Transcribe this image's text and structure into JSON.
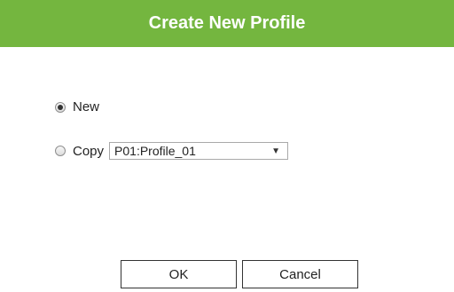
{
  "dialog": {
    "title": "Create New Profile",
    "title_bar_color": "#74b63f",
    "options": {
      "new_label": "New",
      "new_checked": true,
      "copy_label": "Copy",
      "copy_checked": false
    },
    "profile_select": {
      "selected": "P01:Profile_01",
      "arrow_icon": "triangle-down-icon"
    },
    "buttons": {
      "ok_label": "OK",
      "cancel_label": "Cancel"
    }
  }
}
